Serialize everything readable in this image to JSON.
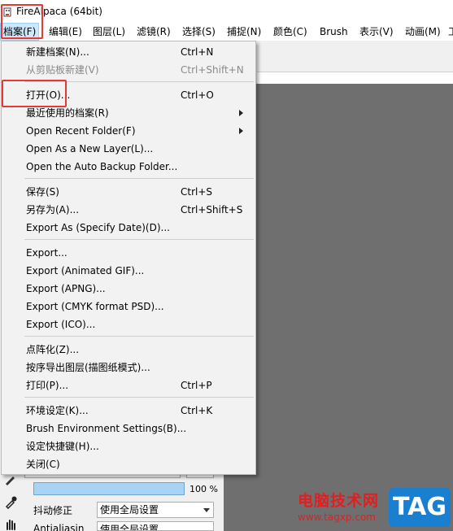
{
  "window": {
    "title": "FireAlpaca (64bit)"
  },
  "menubar": [
    {
      "label": "档案(F)"
    },
    {
      "label": "编辑(E)"
    },
    {
      "label": "图层(L)"
    },
    {
      "label": "滤镜(R)"
    },
    {
      "label": "选择(S)"
    },
    {
      "label": "捕捉(N)"
    },
    {
      "label": "颜色(C)"
    },
    {
      "label": "Brush"
    },
    {
      "label": "表示(V)"
    },
    {
      "label": "动画(M)"
    },
    {
      "label": "工"
    }
  ],
  "file_menu": {
    "items": [
      {
        "label": "新建档案(N)...",
        "shortcut": "Ctrl+N"
      },
      {
        "label": "从剪贴板新建(V)",
        "shortcut": "Ctrl+Shift+N",
        "disabled": true
      },
      {
        "label": "打开(O)...",
        "shortcut": "Ctrl+O"
      },
      {
        "label": "最近使用的档案(R)",
        "shortcut": ""
      },
      {
        "label": "Open Recent Folder(F)",
        "shortcut": ""
      },
      {
        "label": "Open As a New Layer(L)...",
        "shortcut": ""
      },
      {
        "label": "Open the Auto Backup Folder...",
        "shortcut": ""
      },
      {
        "label": "保存(S)",
        "shortcut": "Ctrl+S"
      },
      {
        "label": "另存为(A)...",
        "shortcut": "Ctrl+Shift+S"
      },
      {
        "label": "Export As (Specify Date)(D)...",
        "shortcut": ""
      },
      {
        "label": "Export...",
        "shortcut": ""
      },
      {
        "label": "Export (Animated GIF)...",
        "shortcut": ""
      },
      {
        "label": "Export (APNG)...",
        "shortcut": ""
      },
      {
        "label": "Export (CMYK format PSD)...",
        "shortcut": ""
      },
      {
        "label": "Export (ICO)...",
        "shortcut": ""
      },
      {
        "label": "点阵化(Z)...",
        "shortcut": ""
      },
      {
        "label": "按序导出图层(描图纸模式)...",
        "shortcut": ""
      },
      {
        "label": "打印(P)...",
        "shortcut": "Ctrl+P"
      },
      {
        "label": "环境设定(K)...",
        "shortcut": "Ctrl+K"
      },
      {
        "label": "Brush Environment Settings(B)...",
        "shortcut": ""
      },
      {
        "label": "设定快捷键(H)...",
        "shortcut": ""
      },
      {
        "label": "关闭(C)",
        "shortcut": ""
      }
    ]
  },
  "brush_panel": {
    "opacity": 100,
    "opacity_text": "100 %",
    "stabilizer_label": "抖动修正",
    "stabilizer_value": "使用全局设置",
    "antialias_label": "Antialiasin",
    "antialias_value": "使用全局设置"
  },
  "watermark": {
    "site_name": "电脑技术网",
    "url": "www.tagxp.com",
    "badge": "TAG"
  },
  "colors": {
    "highlight": "#e53935",
    "canvas": "#6f6f6f",
    "menu_active": "#cce8ff",
    "watermark_red": "#e02020",
    "watermark_blue": "#1b7fd1"
  }
}
